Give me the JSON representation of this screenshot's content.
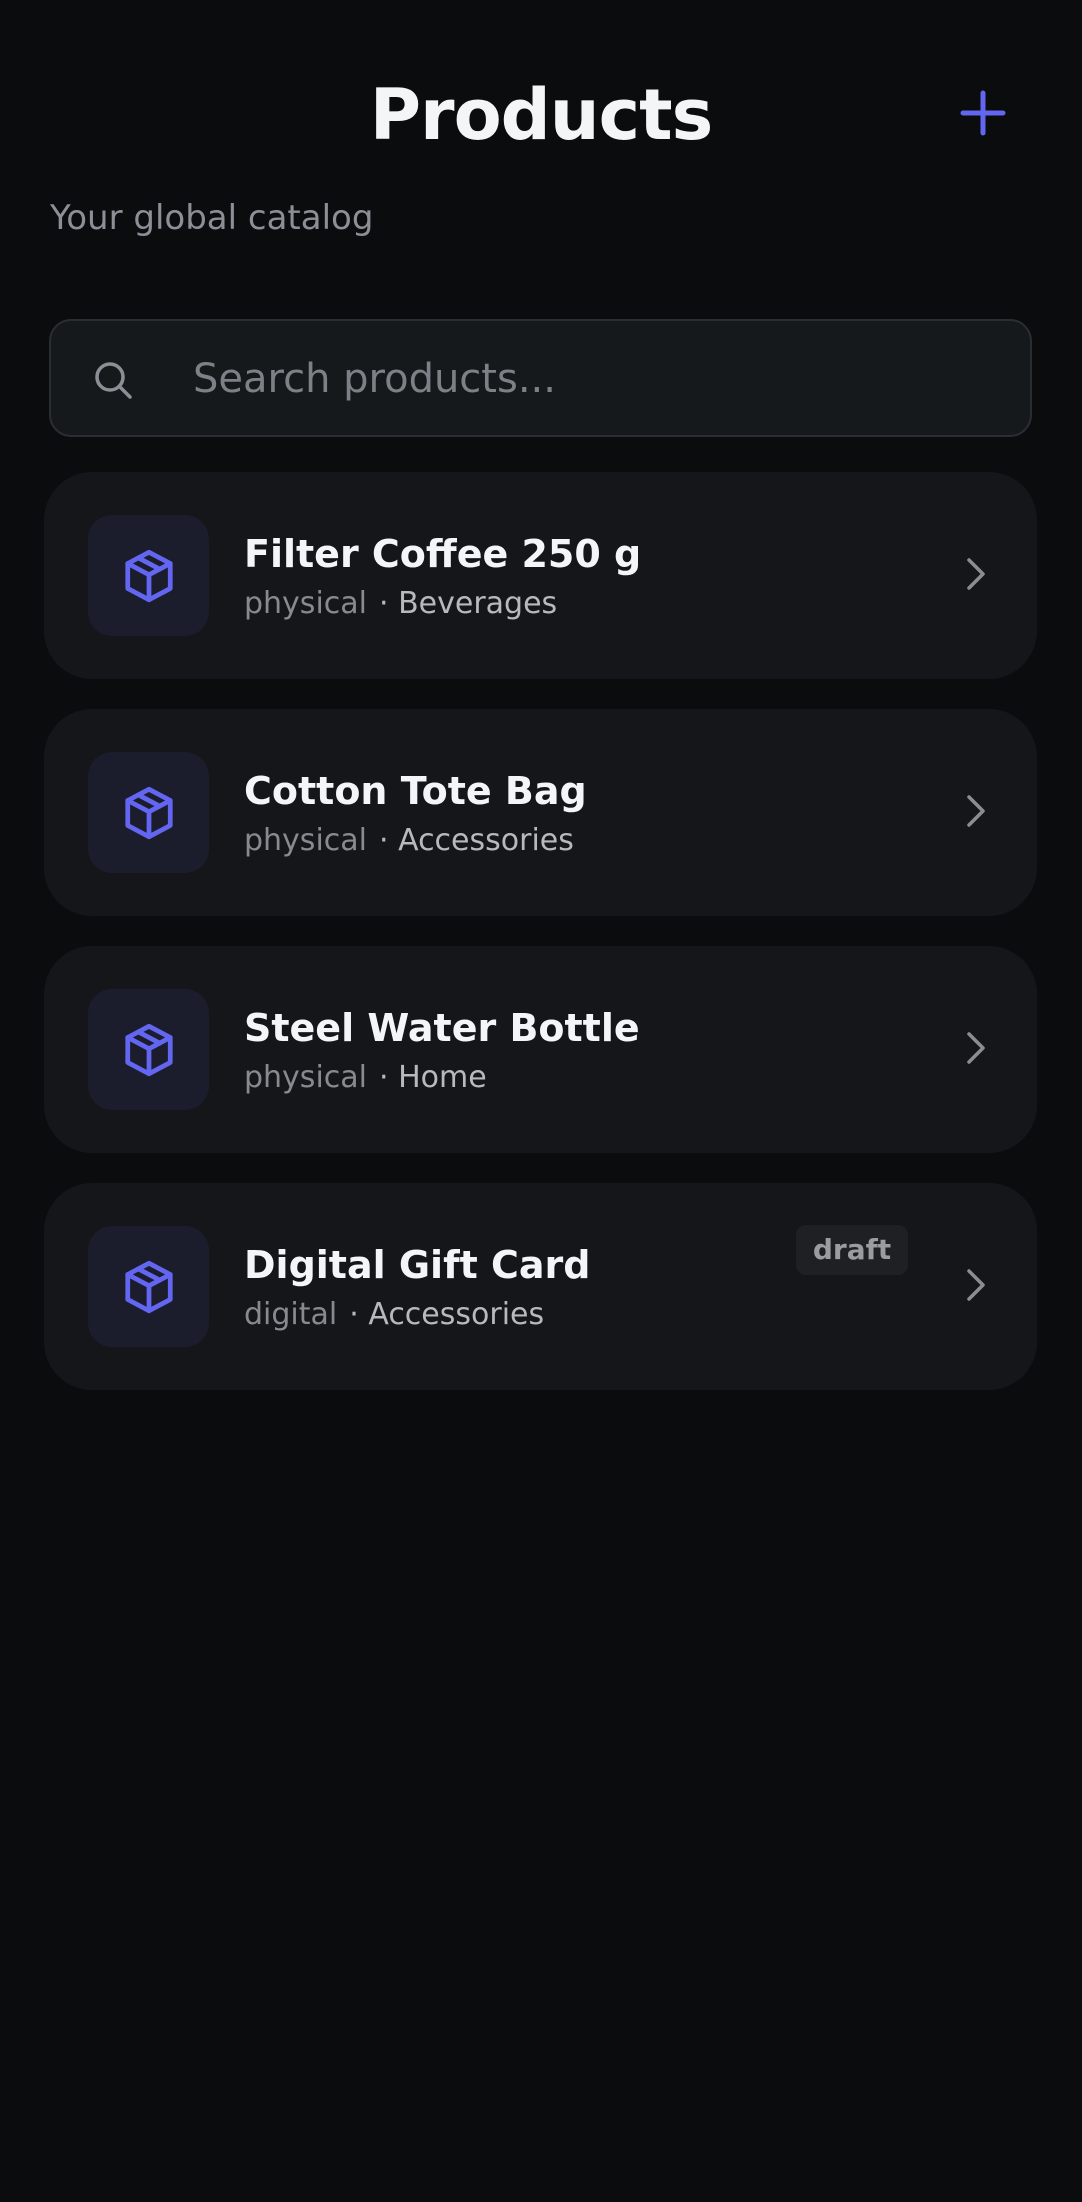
{
  "header": {
    "title": "Products",
    "subtitle": "Your global catalog",
    "add_icon": "plus-icon"
  },
  "search": {
    "placeholder": "Search products...",
    "value": "",
    "icon": "search-icon"
  },
  "products": [
    {
      "name": "Filter Coffee 250 g",
      "type": "physical",
      "category": "· Beverages",
      "status": "",
      "icon": "box-icon"
    },
    {
      "name": "Cotton Tote Bag",
      "type": "physical",
      "category": "· Accessories",
      "status": "",
      "icon": "box-icon"
    },
    {
      "name": "Steel Water Bottle",
      "type": "physical",
      "category": "· Home",
      "status": "",
      "icon": "box-icon"
    },
    {
      "name": "Digital Gift Card",
      "type": "digital",
      "category": "· Accessories",
      "status": "draft",
      "icon": "box-icon"
    }
  ],
  "colors": {
    "background": "#0b0c0e",
    "card": "#151619",
    "accent": "#6366f1",
    "thumb_bg": "#1b1c2c",
    "muted_text": "#8b8f96"
  }
}
